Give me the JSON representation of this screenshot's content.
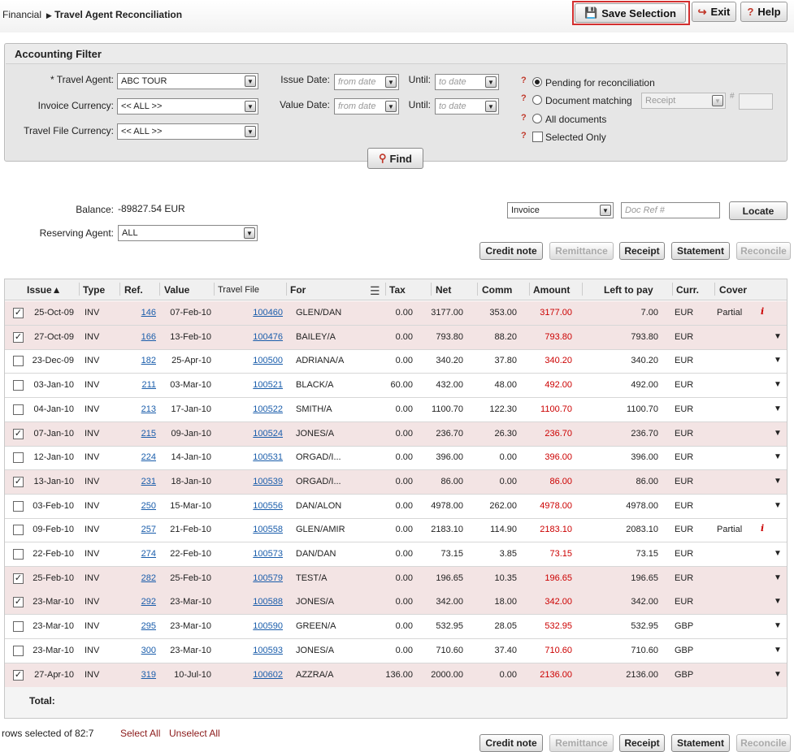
{
  "breadcrumb": {
    "parent": "Financial",
    "current": "Travel Agent Reconciliation"
  },
  "toolbar": {
    "save": "Save Selection",
    "exit": "Exit",
    "help": "Help"
  },
  "filter": {
    "title": "Accounting Filter",
    "travel_agent_label": "* Travel Agent:",
    "travel_agent_value": "ABC TOUR",
    "invoice_currency_label": "Invoice Currency:",
    "invoice_currency_value": "<< ALL >>",
    "file_currency_label": "Travel File Currency:",
    "file_currency_value": "<< ALL >>",
    "issue_date_label": "Issue Date:",
    "value_date_label": "Value Date:",
    "until_label": "Until:",
    "from_placeholder": "from date",
    "to_placeholder": "to date",
    "opt_pending": "Pending for reconciliation",
    "opt_matching": "Document matching",
    "matching_select": "Receipt",
    "hash": "#",
    "opt_all": "All documents",
    "opt_selected": "Selected Only",
    "find": "Find"
  },
  "balance": {
    "label": "Balance:",
    "value": "-89827.54 EUR"
  },
  "reserving": {
    "label": "Reserving Agent:",
    "value": "ALL"
  },
  "locate": {
    "doc_type": "Invoice",
    "placeholder": "Doc Ref #",
    "button": "Locate"
  },
  "actions": {
    "credit": "Credit note",
    "remittance": "Remittance",
    "receipt": "Receipt",
    "statement": "Statement",
    "reconcile": "Reconcile"
  },
  "columns": {
    "issue": "Issue▲",
    "type": "Type",
    "ref": "Ref.",
    "value": "Value",
    "file": "Travel File",
    "for": "For",
    "tax": "Tax",
    "net": "Net",
    "comm": "Comm",
    "amount": "Amount",
    "left": "Left to pay",
    "curr": "Curr.",
    "cover": "Cover"
  },
  "rows": [
    {
      "sel": true,
      "issue": "25-Oct-09",
      "type": "INV",
      "ref": "146",
      "value": "07-Feb-10",
      "file": "100460",
      "for": "GLEN/DAN",
      "tax": "0.00",
      "net": "3177.00",
      "comm": "353.00",
      "amount": "3177.00",
      "left": "7.00",
      "curr": "EUR",
      "cover": "Partial",
      "icon": "info"
    },
    {
      "sel": true,
      "issue": "27-Oct-09",
      "type": "INV",
      "ref": "166",
      "value": "13-Feb-10",
      "file": "100476",
      "for": "BAILEY/A",
      "tax": "0.00",
      "net": "793.80",
      "comm": "88.20",
      "amount": "793.80",
      "left": "793.80",
      "curr": "EUR",
      "cover": "",
      "icon": "arrow"
    },
    {
      "sel": false,
      "issue": "23-Dec-09",
      "type": "INV",
      "ref": "182",
      "value": "25-Apr-10",
      "file": "100500",
      "for": "ADRIANA/A",
      "tax": "0.00",
      "net": "340.20",
      "comm": "37.80",
      "amount": "340.20",
      "left": "340.20",
      "curr": "EUR",
      "cover": "",
      "icon": "arrow"
    },
    {
      "sel": false,
      "issue": "03-Jan-10",
      "type": "INV",
      "ref": "211",
      "value": "03-Mar-10",
      "file": "100521",
      "for": "BLACK/A",
      "tax": "60.00",
      "net": "432.00",
      "comm": "48.00",
      "amount": "492.00",
      "left": "492.00",
      "curr": "EUR",
      "cover": "",
      "icon": "arrow"
    },
    {
      "sel": false,
      "issue": "04-Jan-10",
      "type": "INV",
      "ref": "213",
      "value": "17-Jan-10",
      "file": "100522",
      "for": "SMITH/A",
      "tax": "0.00",
      "net": "1100.70",
      "comm": "122.30",
      "amount": "1100.70",
      "left": "1100.70",
      "curr": "EUR",
      "cover": "",
      "icon": "arrow"
    },
    {
      "sel": true,
      "issue": "07-Jan-10",
      "type": "INV",
      "ref": "215",
      "value": "09-Jan-10",
      "file": "100524",
      "for": "JONES/A",
      "tax": "0.00",
      "net": "236.70",
      "comm": "26.30",
      "amount": "236.70",
      "left": "236.70",
      "curr": "EUR",
      "cover": "",
      "icon": "arrow"
    },
    {
      "sel": false,
      "issue": "12-Jan-10",
      "type": "INV",
      "ref": "224",
      "value": "14-Jan-10",
      "file": "100531",
      "for": "ORGAD/I...",
      "tax": "0.00",
      "net": "396.00",
      "comm": "0.00",
      "amount": "396.00",
      "left": "396.00",
      "curr": "EUR",
      "cover": "",
      "icon": "arrow"
    },
    {
      "sel": true,
      "issue": "13-Jan-10",
      "type": "INV",
      "ref": "231",
      "value": "18-Jan-10",
      "file": "100539",
      "for": "ORGAD/I...",
      "tax": "0.00",
      "net": "86.00",
      "comm": "0.00",
      "amount": "86.00",
      "left": "86.00",
      "curr": "EUR",
      "cover": "",
      "icon": "arrow"
    },
    {
      "sel": false,
      "issue": "03-Feb-10",
      "type": "INV",
      "ref": "250",
      "value": "15-Mar-10",
      "file": "100556",
      "for": "DAN/ALON",
      "tax": "0.00",
      "net": "4978.00",
      "comm": "262.00",
      "amount": "4978.00",
      "left": "4978.00",
      "curr": "EUR",
      "cover": "",
      "icon": "arrow"
    },
    {
      "sel": false,
      "issue": "09-Feb-10",
      "type": "INV",
      "ref": "257",
      "value": "21-Feb-10",
      "file": "100558",
      "for": "GLEN/AMIR",
      "tax": "0.00",
      "net": "2183.10",
      "comm": "114.90",
      "amount": "2183.10",
      "left": "2083.10",
      "curr": "EUR",
      "cover": "Partial",
      "icon": "info"
    },
    {
      "sel": false,
      "issue": "22-Feb-10",
      "type": "INV",
      "ref": "274",
      "value": "22-Feb-10",
      "file": "100573",
      "for": "DAN/DAN",
      "tax": "0.00",
      "net": "73.15",
      "comm": "3.85",
      "amount": "73.15",
      "left": "73.15",
      "curr": "EUR",
      "cover": "",
      "icon": "arrow"
    },
    {
      "sel": true,
      "issue": "25-Feb-10",
      "type": "INV",
      "ref": "282",
      "value": "25-Feb-10",
      "file": "100579",
      "for": "TEST/A",
      "tax": "0.00",
      "net": "196.65",
      "comm": "10.35",
      "amount": "196.65",
      "left": "196.65",
      "curr": "EUR",
      "cover": "",
      "icon": "arrow"
    },
    {
      "sel": true,
      "issue": "23-Mar-10",
      "type": "INV",
      "ref": "292",
      "value": "23-Mar-10",
      "file": "100588",
      "for": "JONES/A",
      "tax": "0.00",
      "net": "342.00",
      "comm": "18.00",
      "amount": "342.00",
      "left": "342.00",
      "curr": "EUR",
      "cover": "",
      "icon": "arrow"
    },
    {
      "sel": false,
      "issue": "23-Mar-10",
      "type": "INV",
      "ref": "295",
      "value": "23-Mar-10",
      "file": "100590",
      "for": "GREEN/A",
      "tax": "0.00",
      "net": "532.95",
      "comm": "28.05",
      "amount": "532.95",
      "left": "532.95",
      "curr": "GBP",
      "cover": "",
      "icon": "arrow"
    },
    {
      "sel": false,
      "issue": "23-Mar-10",
      "type": "INV",
      "ref": "300",
      "value": "23-Mar-10",
      "file": "100593",
      "for": "JONES/A",
      "tax": "0.00",
      "net": "710.60",
      "comm": "37.40",
      "amount": "710.60",
      "left": "710.60",
      "curr": "GBP",
      "cover": "",
      "icon": "arrow"
    },
    {
      "sel": true,
      "issue": "27-Apr-10",
      "type": "INV",
      "ref": "319",
      "value": "10-Jul-10",
      "file": "100602",
      "for": "AZZRA/A",
      "tax": "136.00",
      "net": "2000.00",
      "comm": "0.00",
      "amount": "2136.00",
      "left": "2136.00",
      "curr": "GBP",
      "cover": "",
      "icon": "arrow"
    }
  ],
  "total_label": "Total:",
  "footer": {
    "rows_selected": "rows selected of 82:7",
    "select_all": "Select All",
    "unselect_all": "Unselect All"
  }
}
